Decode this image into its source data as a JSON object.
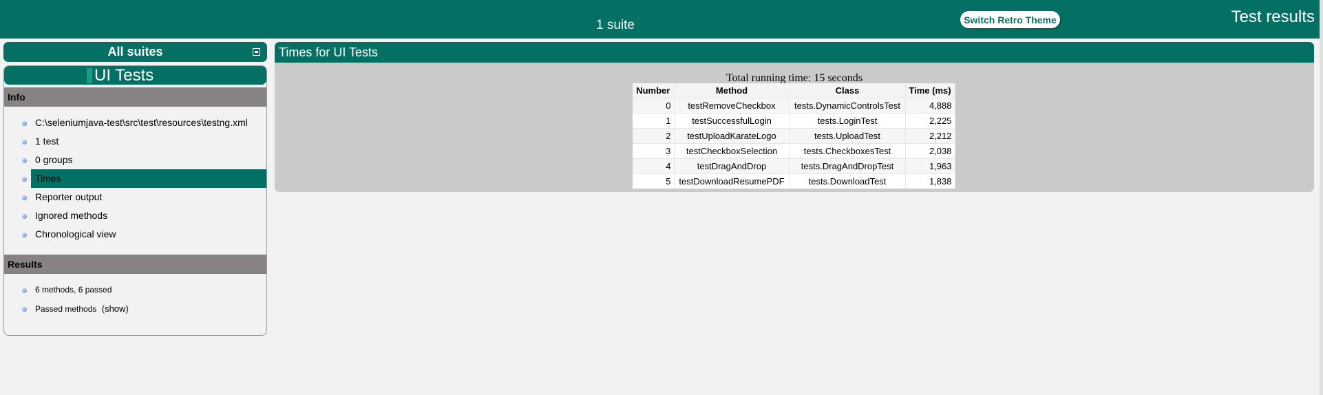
{
  "banner": {
    "suite_count": "1 suite",
    "theme_button": "Switch Retro Theme",
    "report_title": "Test results"
  },
  "navigator": {
    "all_suites": "All suites",
    "suite_name": "UI Tests",
    "info": {
      "header": "Info",
      "items": [
        {
          "label": "C:\\seleniumjava-test\\src\\test\\resources\\testng.xml"
        },
        {
          "label": "1 test"
        },
        {
          "label": "0 groups"
        },
        {
          "label": "Times",
          "selected": true
        },
        {
          "label": "Reporter output"
        },
        {
          "label": "Ignored methods"
        },
        {
          "label": "Chronological view"
        }
      ]
    },
    "results": {
      "header": "Results",
      "summary": "6 methods, 6 passed",
      "passed_label": "Passed methods",
      "show_link": "(show)"
    }
  },
  "main": {
    "header": "Times for UI Tests",
    "total_time": "Total running time: 15 seconds",
    "table": {
      "columns": [
        "Number",
        "Method",
        "Class",
        "Time (ms)"
      ],
      "rows": [
        [
          "0",
          "testRemoveCheckbox",
          "tests.DynamicControlsTest",
          "4,888"
        ],
        [
          "1",
          "testSuccessfulLogin",
          "tests.LoginTest",
          "2,225"
        ],
        [
          "2",
          "testUploadKarateLogo",
          "tests.UploadTest",
          "2,212"
        ],
        [
          "3",
          "testCheckboxSelection",
          "tests.CheckboxesTest",
          "2,038"
        ],
        [
          "4",
          "testDragAndDrop",
          "tests.DragAndDropTest",
          "1,963"
        ],
        [
          "5",
          "testDownloadResumePDF",
          "tests.DownloadTest",
          "1,838"
        ]
      ]
    }
  },
  "colors": {
    "accent": "#047064",
    "section_header": "#888383",
    "panel_bg": "#c9cbcb"
  }
}
